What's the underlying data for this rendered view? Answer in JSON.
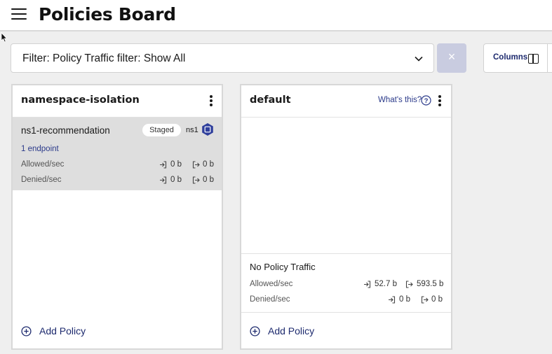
{
  "header": {
    "title": "Policies Board",
    "menu_icon": "hamburger-icon"
  },
  "filter": {
    "text": "Filter: Policy Traffic filter: Show All",
    "clear_label": "×"
  },
  "columns_button": {
    "label": "Columns",
    "icon": "columns-icon"
  },
  "colors": {
    "accent": "#1d2a6e",
    "link": "#2b3a8a",
    "card_bg": "#dedede",
    "clear_bg": "#c9cce0"
  },
  "tiers": [
    {
      "title": "namespace-isolation",
      "policies": [
        {
          "name": "ns1-recommendation",
          "badge": "Staged",
          "namespace": "ns1",
          "endpoints": "1 endpoint",
          "allowed_label": "Allowed/sec",
          "allowed_in": "0 b",
          "allowed_out": "0 b",
          "denied_label": "Denied/sec",
          "denied_in": "0 b",
          "denied_out": "0 b"
        }
      ],
      "add_label": "Add Policy"
    },
    {
      "title": "default",
      "help_label": "What's this?",
      "no_traffic": {
        "title": "No Policy Traffic",
        "allowed_label": "Allowed/sec",
        "allowed_in": "52.7 b",
        "allowed_out": "593.5 b",
        "denied_label": "Denied/sec",
        "denied_in": "0 b",
        "denied_out": "0 b"
      },
      "add_label": "Add Policy"
    }
  ]
}
